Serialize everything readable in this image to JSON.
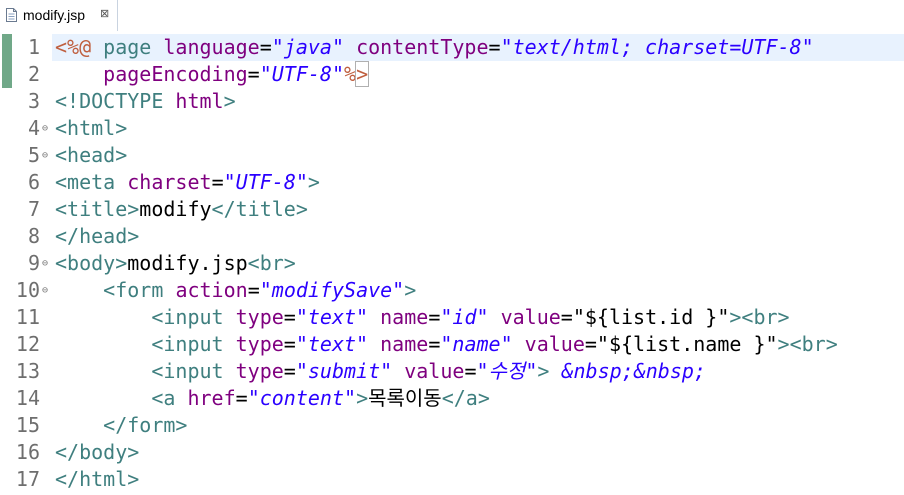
{
  "tab": {
    "filename": "modify.jsp",
    "close_glyph": "⊠",
    "icon": "file-icon"
  },
  "colors": {
    "tag": "#3f7f7f",
    "attribute": "#7f007f",
    "value": "#2a00ff",
    "jsp": "#bf5f3f",
    "text": "#000000"
  },
  "editor": {
    "lines": [
      {
        "num": "1",
        "fold": "",
        "segments": [
          [
            "dir",
            "<%@"
          ],
          [
            "txt",
            " "
          ],
          [
            "tag",
            "page"
          ],
          [
            "txt",
            " "
          ],
          [
            "attr",
            "language"
          ],
          [
            "txt",
            "="
          ],
          [
            "val",
            "\"java\""
          ],
          [
            "txt",
            " "
          ],
          [
            "attr",
            "contentType"
          ],
          [
            "txt",
            "="
          ],
          [
            "val",
            "\"text/html; charset=UTF-8\""
          ]
        ]
      },
      {
        "num": "2",
        "fold": "",
        "segments": [
          [
            "txt",
            "    "
          ],
          [
            "attr",
            "pageEncoding"
          ],
          [
            "txt",
            "="
          ],
          [
            "val",
            "\"UTF-8\""
          ],
          [
            "dir",
            "%"
          ],
          [
            "jspend",
            ">"
          ]
        ]
      },
      {
        "num": "3",
        "fold": "",
        "segments": [
          [
            "tag",
            "<!DOCTYPE"
          ],
          [
            "txt",
            " "
          ],
          [
            "attr",
            "html"
          ],
          [
            "tag",
            ">"
          ]
        ]
      },
      {
        "num": "4",
        "fold": "⊖",
        "segments": [
          [
            "tag",
            "<html>"
          ]
        ]
      },
      {
        "num": "5",
        "fold": "⊖",
        "segments": [
          [
            "tag",
            "<head>"
          ]
        ]
      },
      {
        "num": "6",
        "fold": "",
        "segments": [
          [
            "tag",
            "<meta"
          ],
          [
            "txt",
            " "
          ],
          [
            "attr",
            "charset"
          ],
          [
            "txt",
            "="
          ],
          [
            "val",
            "\"UTF-8\""
          ],
          [
            "tag",
            ">"
          ]
        ]
      },
      {
        "num": "7",
        "fold": "",
        "segments": [
          [
            "tag",
            "<title>"
          ],
          [
            "txt",
            "modify"
          ],
          [
            "tag",
            "</title>"
          ]
        ]
      },
      {
        "num": "8",
        "fold": "",
        "segments": [
          [
            "tag",
            "</head>"
          ]
        ]
      },
      {
        "num": "9",
        "fold": "⊖",
        "segments": [
          [
            "tag",
            "<body>"
          ],
          [
            "txt",
            "modify.jsp"
          ],
          [
            "tag",
            "<br>"
          ]
        ]
      },
      {
        "num": "10",
        "fold": "⊖",
        "segments": [
          [
            "txt",
            "    "
          ],
          [
            "tag",
            "<form"
          ],
          [
            "txt",
            " "
          ],
          [
            "attr",
            "action"
          ],
          [
            "txt",
            "="
          ],
          [
            "val",
            "\"modifySave\""
          ],
          [
            "tag",
            ">"
          ]
        ]
      },
      {
        "num": "11",
        "fold": "",
        "segments": [
          [
            "txt",
            "        "
          ],
          [
            "tag",
            "<input"
          ],
          [
            "txt",
            " "
          ],
          [
            "attr",
            "type"
          ],
          [
            "txt",
            "="
          ],
          [
            "val",
            "\"text\""
          ],
          [
            "txt",
            " "
          ],
          [
            "attr",
            "name"
          ],
          [
            "txt",
            "="
          ],
          [
            "val",
            "\"id\""
          ],
          [
            "txt",
            " "
          ],
          [
            "attr",
            "value"
          ],
          [
            "txt",
            "=\"${list.id }\""
          ],
          [
            "tag",
            ">"
          ],
          [
            "tag",
            "<br>"
          ]
        ]
      },
      {
        "num": "12",
        "fold": "",
        "segments": [
          [
            "txt",
            "        "
          ],
          [
            "tag",
            "<input"
          ],
          [
            "txt",
            " "
          ],
          [
            "attr",
            "type"
          ],
          [
            "txt",
            "="
          ],
          [
            "val",
            "\"text\""
          ],
          [
            "txt",
            " "
          ],
          [
            "attr",
            "name"
          ],
          [
            "txt",
            "="
          ],
          [
            "val",
            "\"name\""
          ],
          [
            "txt",
            " "
          ],
          [
            "attr",
            "value"
          ],
          [
            "txt",
            "=\"${list.name }\""
          ],
          [
            "tag",
            ">"
          ],
          [
            "tag",
            "<br>"
          ]
        ]
      },
      {
        "num": "13",
        "fold": "",
        "segments": [
          [
            "txt",
            "        "
          ],
          [
            "tag",
            "<input"
          ],
          [
            "txt",
            " "
          ],
          [
            "attr",
            "type"
          ],
          [
            "txt",
            "="
          ],
          [
            "val",
            "\"submit\""
          ],
          [
            "txt",
            " "
          ],
          [
            "attr",
            "value"
          ],
          [
            "txt",
            "="
          ],
          [
            "val",
            "\"수정\""
          ],
          [
            "tag",
            ">"
          ],
          [
            "txt",
            " "
          ],
          [
            "val",
            "&nbsp;&nbsp;"
          ]
        ]
      },
      {
        "num": "14",
        "fold": "",
        "segments": [
          [
            "txt",
            "        "
          ],
          [
            "tag",
            "<a"
          ],
          [
            "txt",
            " "
          ],
          [
            "attr",
            "href"
          ],
          [
            "txt",
            "="
          ],
          [
            "val",
            "\"content\""
          ],
          [
            "tag",
            ">"
          ],
          [
            "txt",
            "목록이동"
          ],
          [
            "tag",
            "</a>"
          ]
        ]
      },
      {
        "num": "15",
        "fold": "",
        "segments": [
          [
            "txt",
            "    "
          ],
          [
            "tag",
            "</form>"
          ]
        ]
      },
      {
        "num": "16",
        "fold": "",
        "segments": [
          [
            "tag",
            "</body>"
          ]
        ]
      },
      {
        "num": "17",
        "fold": "",
        "segments": [
          [
            "tag",
            "</html>"
          ]
        ]
      }
    ]
  }
}
